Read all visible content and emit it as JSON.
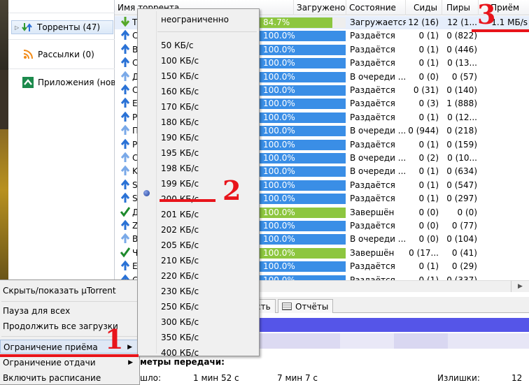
{
  "sidebar": {
    "items": [
      {
        "label": "Торренты (47)",
        "icon": "torrents-icon"
      },
      {
        "label": "Рассылки (0)",
        "icon": "rss-icon"
      },
      {
        "label": "Приложения (новые)",
        "icon": "apps-icon"
      }
    ]
  },
  "list": {
    "headers": {
      "name": "Имя торрента",
      "downloaded": "Загружено",
      "state": "Состояние",
      "seeds": "Сиды",
      "peers": "Пиры",
      "received": "Приём"
    },
    "rows": [
      {
        "letter": "T",
        "icon": "download-arrow-icon",
        "progress": "84.7%",
        "pct": 84.7,
        "state": "Загружается",
        "seeds": "12 (16)",
        "peers": "12 (1...",
        "received": "1.1 MБ/s",
        "color": "#8dc63f"
      },
      {
        "letter": "C",
        "icon": "upload-arrow-icon",
        "progress": "100.0%",
        "pct": 100,
        "state": "Раздаётся",
        "seeds": "0 (1)",
        "peers": "0 (822)",
        "received": "",
        "color": "#3a8ee6"
      },
      {
        "letter": "B",
        "icon": "upload-arrow-icon",
        "progress": "100.0%",
        "pct": 100,
        "state": "Раздаётся",
        "seeds": "0 (1)",
        "peers": "0 (446)",
        "received": "",
        "color": "#3a8ee6"
      },
      {
        "letter": "C",
        "icon": "upload-arrow-icon",
        "progress": "100.0%",
        "pct": 100,
        "state": "Раздаётся",
        "seeds": "0 (1)",
        "peers": "0 (13...",
        "received": "",
        "color": "#3a8ee6"
      },
      {
        "letter": "Д",
        "icon": "queued-upload-icon",
        "progress": "100.0%",
        "pct": 100,
        "state": "В очереди ...",
        "seeds": "0 (0)",
        "peers": "0 (57)",
        "received": "",
        "color": "#3a8ee6"
      },
      {
        "letter": "C",
        "icon": "upload-arrow-icon",
        "progress": "100.0%",
        "pct": 100,
        "state": "Раздаётся",
        "seeds": "0 (31)",
        "peers": "0 (140)",
        "received": "",
        "color": "#3a8ee6"
      },
      {
        "letter": "E",
        "icon": "upload-arrow-icon",
        "progress": "100.0%",
        "pct": 100,
        "state": "Раздаётся",
        "seeds": "0 (3)",
        "peers": "1 (888)",
        "received": "",
        "color": "#3a8ee6"
      },
      {
        "letter": "P",
        "icon": "upload-arrow-icon",
        "progress": "100.0%",
        "pct": 100,
        "state": "Раздаётся",
        "seeds": "0 (1)",
        "peers": "0 (12...",
        "received": "",
        "color": "#3a8ee6"
      },
      {
        "letter": "П",
        "icon": "queued-upload-icon",
        "progress": "100.0%",
        "pct": 100,
        "state": "В очереди ...",
        "seeds": "0 (944)",
        "peers": "0 (218)",
        "received": "",
        "color": "#3a8ee6"
      },
      {
        "letter": "P",
        "icon": "upload-arrow-icon",
        "progress": "100.0%",
        "pct": 100,
        "state": "Раздаётся",
        "seeds": "0 (1)",
        "peers": "0 (159)",
        "received": "",
        "color": "#3a8ee6"
      },
      {
        "letter": "C",
        "icon": "queued-upload-icon",
        "progress": "100.0%",
        "pct": 100,
        "state": "В очереди ...",
        "seeds": "0 (2)",
        "peers": "0 (10...",
        "received": "",
        "color": "#3a8ee6"
      },
      {
        "letter": "K",
        "icon": "queued-upload-icon",
        "progress": "100.0%",
        "pct": 100,
        "state": "В очереди ...",
        "seeds": "0 (1)",
        "peers": "0 (634)",
        "received": "",
        "color": "#3a8ee6"
      },
      {
        "letter": "S",
        "icon": "upload-arrow-icon",
        "progress": "100.0%",
        "pct": 100,
        "state": "Раздаётся",
        "seeds": "0 (1)",
        "peers": "0 (547)",
        "received": "",
        "color": "#3a8ee6"
      },
      {
        "letter": "S",
        "icon": "upload-arrow-icon",
        "progress": "100.0%",
        "pct": 100,
        "state": "Раздаётся",
        "seeds": "0 (1)",
        "peers": "0 (297)",
        "received": "",
        "color": "#3a8ee6"
      },
      {
        "letter": "Д",
        "icon": "checkmark-icon",
        "progress": "100.0%",
        "pct": 100,
        "state": "Завершён",
        "seeds": "0 (0)",
        "peers": "0 (0)",
        "received": "",
        "color": "#8dc63f"
      },
      {
        "letter": "Z",
        "icon": "upload-arrow-icon",
        "progress": "100.0%",
        "pct": 100,
        "state": "Раздаётся",
        "seeds": "0 (0)",
        "peers": "0 (77)",
        "received": "",
        "color": "#3a8ee6"
      },
      {
        "letter": "B",
        "icon": "queued-upload-icon",
        "progress": "100.0%",
        "pct": 100,
        "state": "В очереди ...",
        "seeds": "0 (0)",
        "peers": "0 (104)",
        "received": "",
        "color": "#3a8ee6"
      },
      {
        "letter": "Ч",
        "icon": "checkmark-icon",
        "progress": "100.0%",
        "pct": 100,
        "state": "Завершён",
        "seeds": "0 (17...",
        "peers": "0 (41)",
        "received": "",
        "color": "#8dc63f"
      },
      {
        "letter": "E",
        "icon": "upload-arrow-icon",
        "progress": "100.0%",
        "pct": 100,
        "state": "Раздаётся",
        "seeds": "0 (1)",
        "peers": "0 (29)",
        "received": "",
        "color": "#3a8ee6"
      },
      {
        "letter": "C",
        "icon": "upload-arrow-icon",
        "progress": "100.0%",
        "pct": 100,
        "state": "Раздаётся",
        "seeds": "0 (1)",
        "peers": "0 (337)",
        "received": "",
        "color": "#3a8ee6"
      }
    ]
  },
  "detail": {
    "tabs": [
      "сть",
      "Отчёты"
    ],
    "transfer_title": "метры передачи:",
    "row": [
      {
        "text": "шло:"
      },
      {
        "text": "1 мин 52 с"
      },
      {
        "text": "7 мин 7 с"
      },
      {
        "text": "Излишки:"
      },
      {
        "text": "12"
      }
    ]
  },
  "tray_menu": {
    "items": [
      {
        "label": "Скрыть/показать µTorrent",
        "arrow": false
      },
      {
        "label": "Пауза для всех",
        "arrow": false
      },
      {
        "label": "Продолжить все загрузки",
        "arrow": false
      },
      {
        "label": "Ограничение приёма",
        "arrow": true
      },
      {
        "label": "Ограничение отдачи",
        "arrow": true
      },
      {
        "label": "Включить расписание",
        "arrow": false
      }
    ]
  },
  "speed_menu": {
    "unlimited": "неограниченно",
    "items": [
      "50 КБ/с",
      "100 КБ/с",
      "150 КБ/с",
      "160 КБ/с",
      "170 КБ/с",
      "180 КБ/с",
      "190 КБ/с",
      "195 КБ/с",
      "198 КБ/с",
      "199 КБ/с",
      "200 КБ/с",
      "201 КБ/с",
      "202 КБ/с",
      "205 КБ/с",
      "210 КБ/с",
      "220 КБ/с",
      "230 КБ/с",
      "250 КБ/с",
      "300 КБ/с",
      "350 КБ/с",
      "400 КБ/с"
    ],
    "selected": "200 КБ/с"
  },
  "annotations": {
    "one": "1",
    "two": "2",
    "three": "3"
  },
  "colors": {
    "download": "#8dc63f",
    "upload": "#3a8ee6",
    "annotation": "#e8141b"
  }
}
